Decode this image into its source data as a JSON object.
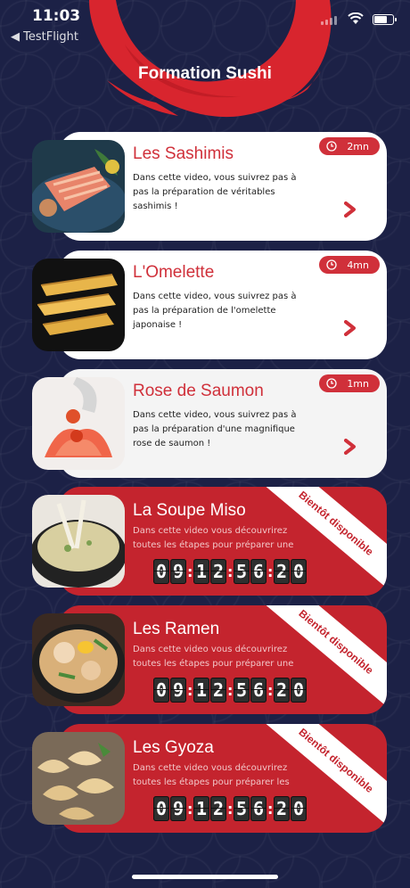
{
  "status_bar": {
    "time": "11:03",
    "back_app": "◀ TestFlight"
  },
  "header": {
    "title": "Formation Sushi"
  },
  "colors": {
    "background": "#1c2146",
    "accent": "#d0303a",
    "locked_card": "#c4242e"
  },
  "videos": [
    {
      "title": "Les Sashimis",
      "description": "Dans cette video, vous suivrez pas à pas la préparation de véritables sashimis !",
      "duration": "2mn",
      "image": "sashimi-photo"
    },
    {
      "title": "L'Omelette",
      "description": "Dans cette video, vous suivrez pas à pas la préparation de l'omelette japonaise !",
      "duration": "4mn",
      "image": "omelette-photo"
    },
    {
      "title": "Rose de Saumon",
      "description": "Dans cette video, vous suivrez pas à pas la préparation d'une magnifique rose de saumon !",
      "duration": "1mn",
      "image": "salmon-rose-photo"
    }
  ],
  "upcoming": [
    {
      "title": "La Soupe Miso",
      "description": "Dans cette video vous découvrirez toutes les étapes pour préparer une",
      "badge": "Bientôt disponible",
      "countdown": [
        "0",
        "9",
        "1",
        "2",
        "5",
        "6",
        "2",
        "0"
      ],
      "image": "miso-soup-photo"
    },
    {
      "title": "Les Ramen",
      "description": "Dans cette video vous découvrirez toutes les étapes pour préparer une",
      "badge": "Bientôt disponible",
      "countdown": [
        "0",
        "9",
        "1",
        "2",
        "5",
        "6",
        "2",
        "0"
      ],
      "image": "ramen-photo"
    },
    {
      "title": "Les Gyoza",
      "description": "Dans cette video vous découvrirez toutes les étapes pour préparer les",
      "badge": "Bientôt disponible",
      "countdown": [
        "0",
        "9",
        "1",
        "2",
        "5",
        "6",
        "2",
        "0"
      ],
      "image": "gyoza-photo"
    }
  ]
}
